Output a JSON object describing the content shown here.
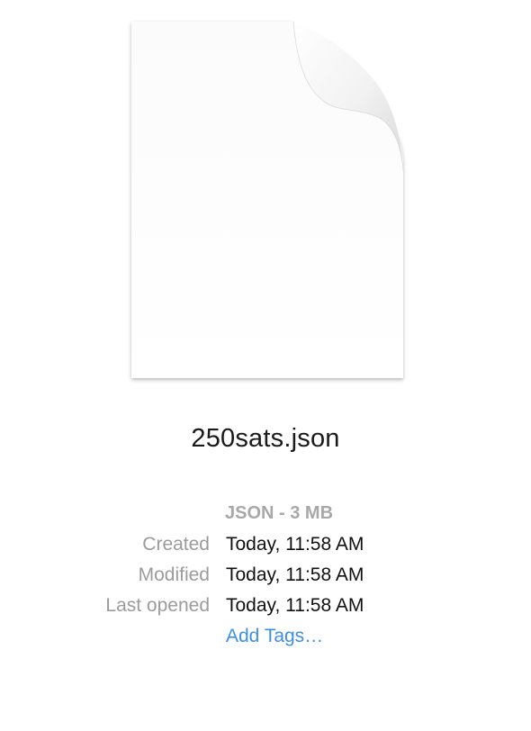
{
  "file": {
    "icon": "document-icon",
    "name": "250sats.json",
    "kind_size": "JSON - 3 MB"
  },
  "metadata": [
    {
      "label": "Created",
      "value": "Today, 11:58 AM"
    },
    {
      "label": "Modified",
      "value": "Today, 11:58 AM"
    },
    {
      "label": "Last opened",
      "value": "Today, 11:58 AM"
    }
  ],
  "tags": {
    "add_label": "Add Tags…"
  },
  "colors": {
    "label_gray": "#9b9b9b",
    "kind_gray": "#a8a8a8",
    "link_blue": "#3d8ee8"
  }
}
